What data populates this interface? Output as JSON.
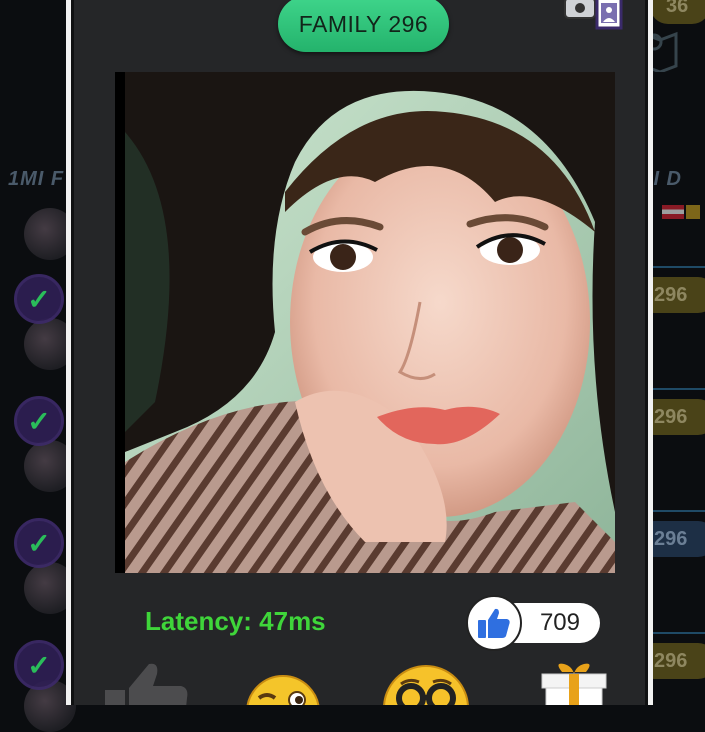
{
  "background": {
    "header_left": "1MI F",
    "header_right": "DI D",
    "top_badge": "36",
    "pills": [
      "296",
      "296",
      "296",
      "296"
    ]
  },
  "modal": {
    "title": "FAMILY 296",
    "latency_label": "Latency: 47ms",
    "likes_count": "709",
    "icons": {
      "report": "report-photo-icon",
      "like": "thumbs-up-icon",
      "actions": [
        "thumbs-up-icon",
        "wink-emoji-icon",
        "nerd-emoji-icon",
        "gift-icon"
      ]
    },
    "colors": {
      "title_pill": "#2ec97b",
      "latency_text": "#3fd53a",
      "like_blue": "#2f6fe0"
    }
  }
}
